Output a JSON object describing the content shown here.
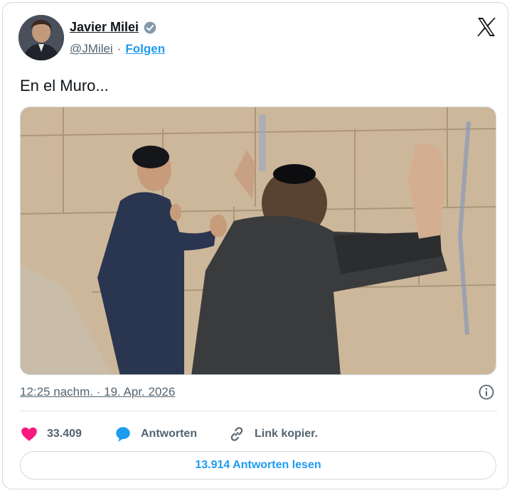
{
  "author": {
    "display_name": "Javier Milei",
    "handle": "@JMilei",
    "separator": "·",
    "follow_label": "Folgen"
  },
  "tweet": {
    "text": "En el Muro...",
    "timestamp": "12:25 nachm. · 19. Apr. 2026"
  },
  "actions": {
    "likes_count": "33.409",
    "reply_label": "Antworten",
    "copy_link_label": "Link kopier."
  },
  "read_replies_label": "13.914 Antworten lesen",
  "colors": {
    "accent": "#1d9bf0",
    "like": "#f91880",
    "muted_text": "#536471",
    "border": "#cfd9de"
  },
  "icons": {
    "verified": "verified-badge-icon",
    "close": "close-x-icon",
    "info": "info-icon",
    "like": "heart-icon",
    "reply": "speech-bubble-icon",
    "link": "link-icon"
  }
}
